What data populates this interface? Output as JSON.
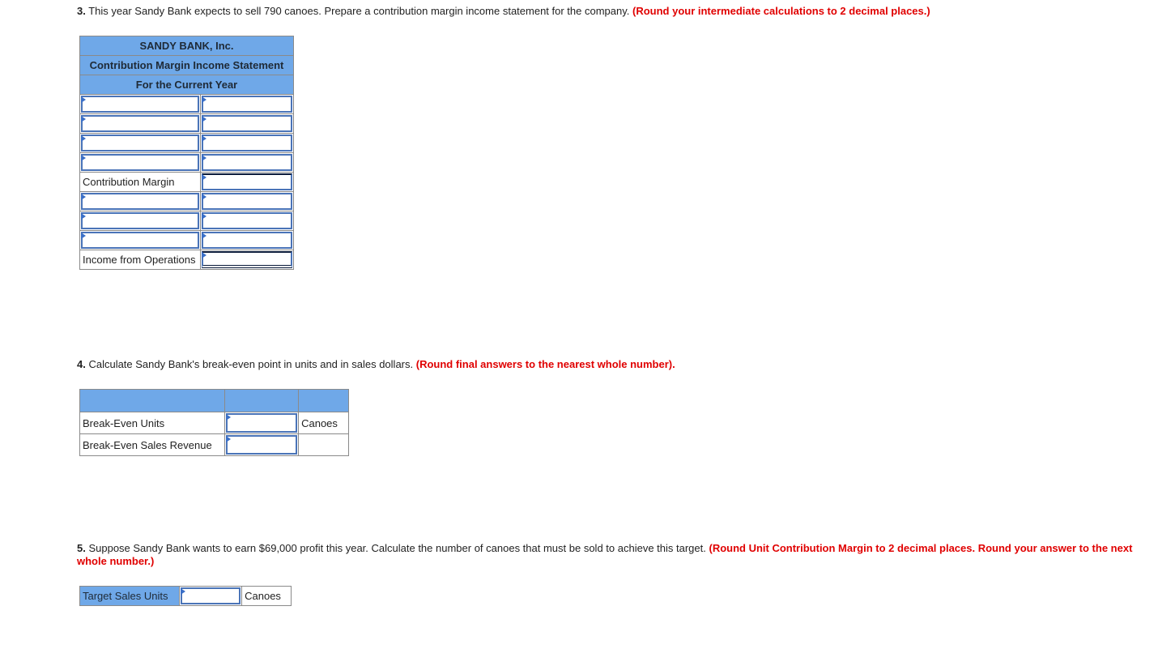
{
  "q3": {
    "number": "3.",
    "text": " This year Sandy Bank expects to sell 790 canoes. Prepare a contribution margin income statement for the company. ",
    "hint": "(Round your intermediate calculations to 2 decimal places.)",
    "statement": {
      "company": "SANDY BANK, Inc.",
      "title": "Contribution Margin Income Statement",
      "period": "For the Current Year",
      "rows": [
        {
          "label": "",
          "value": ""
        },
        {
          "label": "",
          "value": ""
        },
        {
          "label": "",
          "value": ""
        },
        {
          "label": "",
          "value": ""
        },
        {
          "label": "Contribution Margin",
          "value": ""
        },
        {
          "label": "",
          "value": ""
        },
        {
          "label": "",
          "value": ""
        },
        {
          "label": "",
          "value": ""
        },
        {
          "label": "Income from Operations",
          "value": ""
        }
      ]
    }
  },
  "q4": {
    "number": "4.",
    "text": " Calculate Sandy Bank's break-even point in units and in sales dollars. ",
    "hint": "(Round final answers to the nearest whole number).",
    "rows": [
      {
        "label": "Break-Even Units",
        "value": "",
        "unit": "Canoes"
      },
      {
        "label": "Break-Even Sales Revenue",
        "value": "",
        "unit": ""
      }
    ]
  },
  "q5": {
    "number": "5.",
    "text": " Suppose Sandy Bank wants to earn $69,000 profit this year. Calculate the number of canoes that must be sold to achieve this target. ",
    "hint": "(Round Unit Contribution Margin to 2 decimal places. Round your answer to the next whole number.)",
    "row": {
      "label": "Target Sales Units",
      "value": "",
      "unit": "Canoes"
    }
  }
}
